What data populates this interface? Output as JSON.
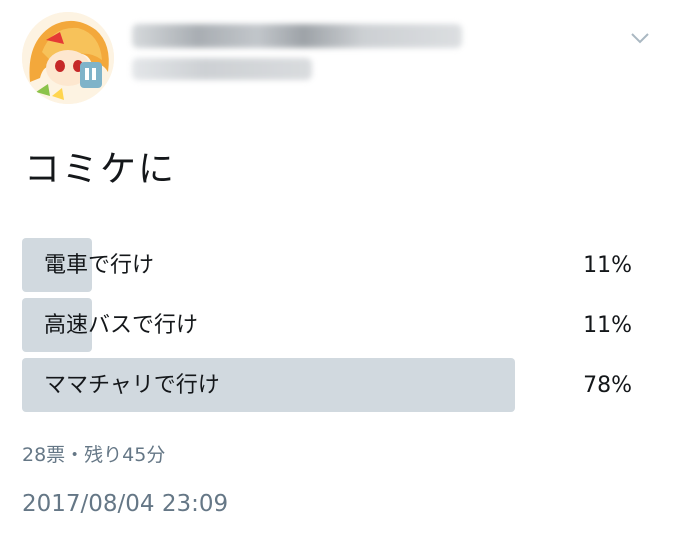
{
  "tweet": {
    "text": "コミケに"
  },
  "poll": {
    "options": [
      {
        "label": "電車で行け",
        "percent_text": "11%",
        "percent": 11
      },
      {
        "label": "高速バスで行け",
        "percent_text": "11%",
        "percent": 11
      },
      {
        "label": "ママチャリで行け",
        "percent_text": "78%",
        "percent": 78
      }
    ],
    "meta": "28票・残り45分"
  },
  "timestamp": "2017/08/04 23:09",
  "icons": {
    "avatar": "avatar",
    "caret": "chevron-down-icon"
  },
  "colors": {
    "bar": "#d1d9df",
    "text": "#14171a",
    "secondary": "#657786"
  }
}
